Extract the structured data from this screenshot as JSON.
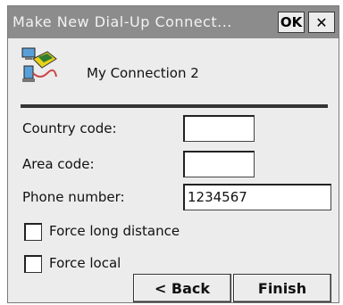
{
  "window": {
    "title": "Make New Dial-Up Connect...",
    "ok_label": "OK",
    "close_label": "✕"
  },
  "connection": {
    "icon": "dialup-connection-icon",
    "name": "My Connection 2"
  },
  "form": {
    "country_code": {
      "label": "Country code:",
      "value": ""
    },
    "area_code": {
      "label": "Area code:",
      "value": ""
    },
    "phone_number": {
      "label": "Phone number:",
      "value": "1234567"
    },
    "force_long_distance": {
      "label": "Force long distance",
      "checked": false
    },
    "force_local": {
      "label": "Force local",
      "checked": false
    }
  },
  "buttons": {
    "back_label": "< Back",
    "finish_label": "Finish"
  },
  "colors": {
    "titlebar": "#8c8c8c",
    "dialog_bg": "#ececec"
  }
}
